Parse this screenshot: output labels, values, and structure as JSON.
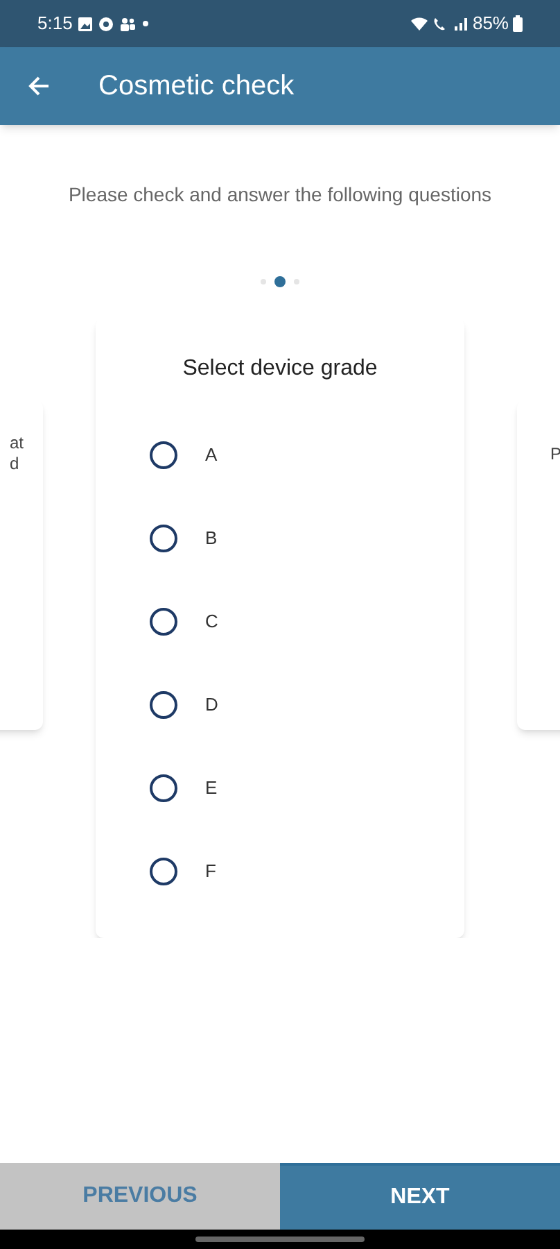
{
  "status_bar": {
    "time": "5:15",
    "battery": "85%"
  },
  "app_bar": {
    "title": "Cosmetic check"
  },
  "instruction": "Please check and answer the following questions",
  "pages": [
    {
      "selected": false
    },
    {
      "selected": true
    },
    {
      "selected": false
    }
  ],
  "previous_card": {
    "lines": [
      "at",
      "d"
    ]
  },
  "card": {
    "question": "Select device grade",
    "options": [
      {
        "label": "A",
        "selected": false
      },
      {
        "label": "B",
        "selected": false
      },
      {
        "label": "C",
        "selected": false
      },
      {
        "label": "D",
        "selected": false
      },
      {
        "label": "E",
        "selected": false
      },
      {
        "label": "F",
        "selected": false
      }
    ]
  },
  "next_card": {
    "lines": [
      "P"
    ]
  },
  "buttons": [
    {
      "label": "PREVIOUS",
      "kind": "secondary"
    },
    {
      "label": "NEXT",
      "kind": "primary"
    }
  ]
}
